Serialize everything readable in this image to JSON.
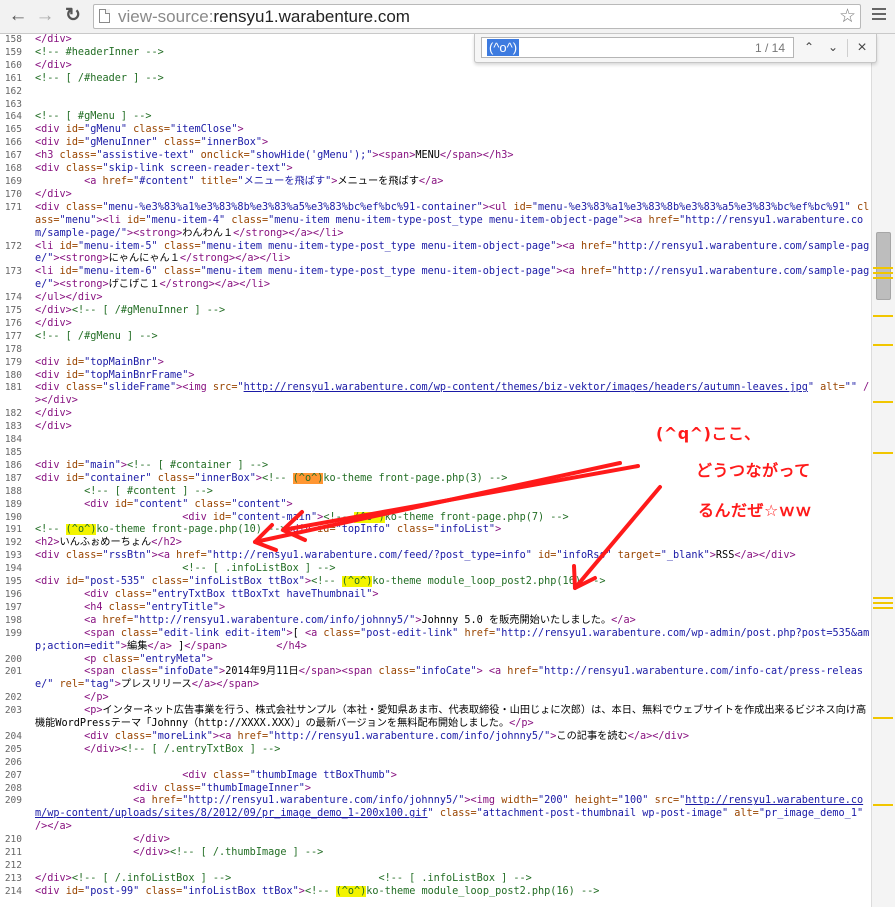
{
  "browser": {
    "url_scheme": "view-source:",
    "url_host": "rensyu1.warabenture.com",
    "back_glyph": "←",
    "forward_glyph": "→",
    "reload_glyph": "↻",
    "star_glyph": "☆"
  },
  "find": {
    "query": "(^o^)",
    "count": "1 / 14",
    "prev_glyph": "⌃",
    "next_glyph": "⌄",
    "close_glyph": "×"
  },
  "annotation": {
    "line1": "(^q^)ここ、",
    "line2": "どうつながって",
    "line3": "るんだぜ☆ｗｗ",
    "color": "#ff1a1a"
  },
  "source_lines": [
    {
      "n": "158",
      "html": "<span class=\"tag\">&lt;/div&gt;</span>"
    },
    {
      "n": "159",
      "html": "<span class=\"cm\">&lt;!-- #headerInner --&gt;</span>"
    },
    {
      "n": "160",
      "html": "<span class=\"tag\">&lt;/div&gt;</span>"
    },
    {
      "n": "161",
      "html": "<span class=\"cm\">&lt;!-- [ /#header ] --&gt;</span>"
    },
    {
      "n": "162",
      "html": ""
    },
    {
      "n": "163",
      "html": ""
    },
    {
      "n": "164",
      "html": "<span class=\"cm\">&lt;!-- [ #gMenu ] --&gt;</span>"
    },
    {
      "n": "165",
      "html": "<span class=\"tag\">&lt;div</span> <span class=\"an\">id=</span><span class=\"av\">\"gMenu\"</span> <span class=\"an\">class=</span><span class=\"av\">\"itemClose\"</span><span class=\"tag\">&gt;</span>"
    },
    {
      "n": "166",
      "html": "<span class=\"tag\">&lt;div</span> <span class=\"an\">id=</span><span class=\"av\">\"gMenuInner\"</span> <span class=\"an\">class=</span><span class=\"av\">\"innerBox\"</span><span class=\"tag\">&gt;</span>"
    },
    {
      "n": "167",
      "html": "<span class=\"tag\">&lt;h3</span> <span class=\"an\">class=</span><span class=\"av\">\"assistive-text\"</span> <span class=\"an\">onclick=</span><span class=\"av\">\"showHide('gMenu');\"</span><span class=\"tag\">&gt;&lt;span&gt;</span>MENU<span class=\"tag\">&lt;/span&gt;&lt;/h3&gt;</span>"
    },
    {
      "n": "168",
      "html": "<span class=\"tag\">&lt;div</span> <span class=\"an\">class=</span><span class=\"av\">\"skip-link screen-reader-text\"</span><span class=\"tag\">&gt;</span>"
    },
    {
      "n": "169",
      "html": "\t<span class=\"tag\">&lt;a</span> <span class=\"an\">href=</span><span class=\"av\">\"#content\"</span> <span class=\"an\">title=</span><span class=\"av\">\"メニューを飛ばす\"</span><span class=\"tag\">&gt;</span>メニューを飛ばす<span class=\"tag\">&lt;/a&gt;</span>"
    },
    {
      "n": "170",
      "html": "<span class=\"tag\">&lt;/div&gt;</span>"
    },
    {
      "n": "171",
      "html": "<span class=\"tag\">&lt;div</span> <span class=\"an\">class=</span><span class=\"av\">\"menu-%e3%83%a1%e3%83%8b%e3%83%a5%e3%83%bc%ef%bc%91-container\"</span><span class=\"tag\">&gt;&lt;ul</span> <span class=\"an\">id=</span><span class=\"av\">\"menu-%e3%83%a1%e3%83%8b%e3%83%a5%e3%83%bc%ef%bc%91\"</span> <span class=\"an\">class=</span><span class=\"av\">\"menu\"</span><span class=\"tag\">&gt;&lt;li</span> <span class=\"an\">id=</span><span class=\"av\">\"menu-item-4\"</span> <span class=\"an\">class=</span><span class=\"av\">\"menu-item menu-item-type-post_type menu-item-object-page\"</span><span class=\"tag\">&gt;&lt;a</span> <span class=\"an\">href=</span><span class=\"av\">\"http://rensyu1.warabenture.com/sample-page/\"</span><span class=\"tag\">&gt;&lt;strong&gt;</span>わんわん１<span class=\"tag\">&lt;/strong&gt;&lt;/a&gt;&lt;/li&gt;</span>"
    },
    {
      "n": "172",
      "html": "<span class=\"tag\">&lt;li</span> <span class=\"an\">id=</span><span class=\"av\">\"menu-item-5\"</span> <span class=\"an\">class=</span><span class=\"av\">\"menu-item menu-item-type-post_type menu-item-object-page\"</span><span class=\"tag\">&gt;&lt;a</span> <span class=\"an\">href=</span><span class=\"av\">\"http://rensyu1.warabenture.com/sample-page/\"</span><span class=\"tag\">&gt;&lt;strong&gt;</span>にゃんにゃん１<span class=\"tag\">&lt;/strong&gt;&lt;/a&gt;&lt;/li&gt;</span>"
    },
    {
      "n": "173",
      "html": "<span class=\"tag\">&lt;li</span> <span class=\"an\">id=</span><span class=\"av\">\"menu-item-6\"</span> <span class=\"an\">class=</span><span class=\"av\">\"menu-item menu-item-type-post_type menu-item-object-page\"</span><span class=\"tag\">&gt;&lt;a</span> <span class=\"an\">href=</span><span class=\"av\">\"http://rensyu1.warabenture.com/sample-page/\"</span><span class=\"tag\">&gt;&lt;strong&gt;</span>げこげこ１<span class=\"tag\">&lt;/strong&gt;&lt;/a&gt;&lt;/li&gt;</span>"
    },
    {
      "n": "174",
      "html": "<span class=\"tag\">&lt;/ul&gt;&lt;/div&gt;</span>"
    },
    {
      "n": "175",
      "html": "<span class=\"tag\">&lt;/div&gt;</span><span class=\"cm\">&lt;!-- [ /#gMenuInner ] --&gt;</span>"
    },
    {
      "n": "176",
      "html": "<span class=\"tag\">&lt;/div&gt;</span>"
    },
    {
      "n": "177",
      "html": "<span class=\"cm\">&lt;!-- [ /#gMenu ] --&gt;</span>"
    },
    {
      "n": "178",
      "html": ""
    },
    {
      "n": "179",
      "html": "<span class=\"tag\">&lt;div</span> <span class=\"an\">id=</span><span class=\"av\">\"topMainBnr\"</span><span class=\"tag\">&gt;</span>"
    },
    {
      "n": "180",
      "html": "<span class=\"tag\">&lt;div</span> <span class=\"an\">id=</span><span class=\"av\">\"topMainBnrFrame\"</span><span class=\"tag\">&gt;</span>"
    },
    {
      "n": "181",
      "html": "<span class=\"tag\">&lt;div</span> <span class=\"an\">class=</span><span class=\"av\">\"slideFrame\"</span><span class=\"tag\">&gt;&lt;img</span> <span class=\"an\">src=</span><span class=\"av\">\"<span class=\"lk\">http://rensyu1.warabenture.com/wp-content/themes/biz-vektor/images/headers/autumn-leaves.jpg</span>\"</span> <span class=\"an\">alt=</span><span class=\"av\">\"\"</span> <span class=\"tag\">/&gt;&lt;/div&gt;</span>"
    },
    {
      "n": "182",
      "html": "<span class=\"tag\">&lt;/div&gt;</span>"
    },
    {
      "n": "183",
      "html": "<span class=\"tag\">&lt;/div&gt;</span>"
    },
    {
      "n": "184",
      "html": ""
    },
    {
      "n": "185",
      "html": ""
    },
    {
      "n": "186",
      "html": "<span class=\"tag\">&lt;div</span> <span class=\"an\">id=</span><span class=\"av\">\"main\"</span><span class=\"tag\">&gt;</span><span class=\"cm\">&lt;!-- [ #container ] --&gt;</span>"
    },
    {
      "n": "187",
      "html": "<span class=\"tag\">&lt;div</span> <span class=\"an\">id=</span><span class=\"av\">\"container\"</span> <span class=\"an\">class=</span><span class=\"av\">\"innerBox\"</span><span class=\"tag\">&gt;</span><span class=\"cm\">&lt;!-- <span class=\"hla\">(^o^)</span>ko-theme front-page.php(3) --&gt;</span>"
    },
    {
      "n": "188",
      "html": "\t<span class=\"cm\">&lt;!-- [ #content ] --&gt;</span>"
    },
    {
      "n": "189",
      "html": "\t<span class=\"tag\">&lt;div</span> <span class=\"an\">id=</span><span class=\"av\">\"content\"</span> <span class=\"an\">class=</span><span class=\"av\">\"content\"</span><span class=\"tag\">&gt;</span>"
    },
    {
      "n": "190",
      "html": "\t\t\t<span class=\"tag\">&lt;div</span> <span class=\"an\">id=</span><span class=\"av\">\"content-main\"</span><span class=\"tag\">&gt;</span><span class=\"cm\">&lt;!-- <span class=\"hl\">(^o^)</span>ko-theme front-page.php(7) --&gt;</span>"
    },
    {
      "n": "191",
      "html": "<span class=\"cm\">&lt;!-- <span class=\"hl\">(^o^)</span>ko-theme front-page.php(10) --&gt;</span><span class=\"tag\">&lt;div</span> <span class=\"an\">id=</span><span class=\"av\">\"topInfo\"</span> <span class=\"an\">class=</span><span class=\"av\">\"infoList\"</span><span class=\"tag\">&gt;</span>"
    },
    {
      "n": "192",
      "html": "<span class=\"tag\">&lt;h2&gt;</span>いんふぉめーちょん<span class=\"tag\">&lt;/h2&gt;</span>"
    },
    {
      "n": "193",
      "html": "<span class=\"tag\">&lt;div</span> <span class=\"an\">class=</span><span class=\"av\">\"rssBtn\"</span><span class=\"tag\">&gt;&lt;a</span> <span class=\"an\">href=</span><span class=\"av\">\"http://rensyu1.warabenture.com/feed/?post_type=info\"</span> <span class=\"an\">id=</span><span class=\"av\">\"infoRss\"</span> <span class=\"an\">target=</span><span class=\"av\">\"_blank\"</span><span class=\"tag\">&gt;</span>RSS<span class=\"tag\">&lt;/a&gt;&lt;/div&gt;</span>"
    },
    {
      "n": "194",
      "html": "\t\t\t<span class=\"cm\">&lt;!-- [ .infoListBox ] --&gt;</span>"
    },
    {
      "n": "195",
      "html": "<span class=\"tag\">&lt;div</span> <span class=\"an\">id=</span><span class=\"av\">\"post-535\"</span> <span class=\"an\">class=</span><span class=\"av\">\"infoListBox ttBox\"</span><span class=\"tag\">&gt;</span><span class=\"cm\">&lt;!-- <span class=\"hl\">(^o^)</span>ko-theme module_loop_post2.php(16) --&gt;</span>"
    },
    {
      "n": "196",
      "html": "\t<span class=\"tag\">&lt;div</span> <span class=\"an\">class=</span><span class=\"av\">\"entryTxtBox ttBoxTxt haveThumbnail\"</span><span class=\"tag\">&gt;</span>"
    },
    {
      "n": "197",
      "html": "\t<span class=\"tag\">&lt;h4</span> <span class=\"an\">class=</span><span class=\"av\">\"entryTitle\"</span><span class=\"tag\">&gt;</span>"
    },
    {
      "n": "198",
      "html": "\t<span class=\"tag\">&lt;a</span> <span class=\"an\">href=</span><span class=\"av\">\"http://rensyu1.warabenture.com/info/johnny5/\"</span><span class=\"tag\">&gt;</span>Johnny 5.0 を販売開始いたしました。<span class=\"tag\">&lt;/a&gt;</span>"
    },
    {
      "n": "199",
      "html": "\t<span class=\"tag\">&lt;span</span> <span class=\"an\">class=</span><span class=\"av\">\"edit-link edit-item\"</span><span class=\"tag\">&gt;</span>[ <span class=\"tag\">&lt;a</span> <span class=\"an\">class=</span><span class=\"av\">\"post-edit-link\"</span> <span class=\"an\">href=</span><span class=\"av\">\"http://rensyu1.warabenture.com/wp-admin/post.php?post=535&amp;amp;action=edit\"</span><span class=\"tag\">&gt;</span>編集<span class=\"tag\">&lt;/a&gt;</span> ]<span class=\"tag\">&lt;/span&gt;</span>\t<span class=\"tag\">&lt;/h4&gt;</span>"
    },
    {
      "n": "200",
      "html": "\t<span class=\"tag\">&lt;p</span> <span class=\"an\">class=</span><span class=\"av\">\"entryMeta\"</span><span class=\"tag\">&gt;</span>"
    },
    {
      "n": "201",
      "html": "\t<span class=\"tag\">&lt;span</span> <span class=\"an\">class=</span><span class=\"av\">\"infoDate\"</span><span class=\"tag\">&gt;</span>2014年9月11日<span class=\"tag\">&lt;/span&gt;&lt;span</span> <span class=\"an\">class=</span><span class=\"av\">\"infoCate\"</span><span class=\"tag\">&gt;</span> <span class=\"tag\">&lt;a</span> <span class=\"an\">href=</span><span class=\"av\">\"http://rensyu1.warabenture.com/info-cat/press-release/\"</span> <span class=\"an\">rel=</span><span class=\"av\">\"tag\"</span><span class=\"tag\">&gt;</span>プレスリリース<span class=\"tag\">&lt;/a&gt;&lt;/span&gt;</span>"
    },
    {
      "n": "202",
      "html": "\t<span class=\"tag\">&lt;/p&gt;</span>"
    },
    {
      "n": "203",
      "html": "\t<span class=\"tag\">&lt;p&gt;</span>インターネット広告事業を行う、株式会社サンプル（本社・愛知県あま市、代表取締役・山田じょに次郎）は、本日、無料でウェブサイトを作成出来るビジネス向け高機能WordPressテーマ「Johnny（http://XXXX.XXX）」の最新バージョンを無料配布開始しました。<span class=\"tag\">&lt;/p&gt;</span>"
    },
    {
      "n": "204",
      "html": "\t<span class=\"tag\">&lt;div</span> <span class=\"an\">class=</span><span class=\"av\">\"moreLink\"</span><span class=\"tag\">&gt;&lt;a</span> <span class=\"an\">href=</span><span class=\"av\">\"http://rensyu1.warabenture.com/info/johnny5/\"</span><span class=\"tag\">&gt;</span>この記事を読む<span class=\"tag\">&lt;/a&gt;&lt;/div&gt;</span>"
    },
    {
      "n": "205",
      "html": "\t<span class=\"tag\">&lt;/div&gt;</span><span class=\"cm\">&lt;!-- [ /.entryTxtBox ] --&gt;</span>"
    },
    {
      "n": "206",
      "html": ""
    },
    {
      "n": "207",
      "html": "\t\t\t<span class=\"tag\">&lt;div</span> <span class=\"an\">class=</span><span class=\"av\">\"thumbImage ttBoxThumb\"</span><span class=\"tag\">&gt;</span>"
    },
    {
      "n": "208",
      "html": "\t\t<span class=\"tag\">&lt;div</span> <span class=\"an\">class=</span><span class=\"av\">\"thumbImageInner\"</span><span class=\"tag\">&gt;</span>"
    },
    {
      "n": "209",
      "html": "\t\t<span class=\"tag\">&lt;a</span> <span class=\"an\">href=</span><span class=\"av\">\"http://rensyu1.warabenture.com/info/johnny5/\"</span><span class=\"tag\">&gt;&lt;img</span> <span class=\"an\">width=</span><span class=\"av\">\"200\"</span> <span class=\"an\">height=</span><span class=\"av\">\"100\"</span> <span class=\"an\">src=</span><span class=\"av\">\"<span class=\"lk\">http://rensyu1.warabenture.com/wp-content/uploads/sites/8/2012/09/pr_image_demo_1-200x100.gif</span>\"</span> <span class=\"an\">class=</span><span class=\"av\">\"attachment-post-thumbnail wp-post-image\"</span> <span class=\"an\">alt=</span><span class=\"av\">\"pr_image_demo_1\"</span> <span class=\"tag\">/&gt;&lt;/a&gt;</span>"
    },
    {
      "n": "210",
      "html": "\t\t<span class=\"tag\">&lt;/div&gt;</span>"
    },
    {
      "n": "211",
      "html": "\t\t<span class=\"tag\">&lt;/div&gt;</span><span class=\"cm\">&lt;!-- [ /.thumbImage ] --&gt;</span>"
    },
    {
      "n": "212",
      "html": ""
    },
    {
      "n": "213",
      "html": "<span class=\"tag\">&lt;/div&gt;</span><span class=\"cm\">&lt;!-- [ /.infoListBox ] --&gt;</span>\t\t\t<span class=\"cm\">&lt;!-- [ .infoListBox ] --&gt;</span>"
    },
    {
      "n": "214",
      "html": "<span class=\"tag\">&lt;div</span> <span class=\"an\">id=</span><span class=\"av\">\"post-99\"</span> <span class=\"an\">class=</span><span class=\"av\">\"infoListBox ttBox\"</span><span class=\"tag\">&gt;</span><span class=\"cm\">&lt;!-- <span class=\"hl\">(^o^)</span>ko-theme module_loop_post2.php(16) --&gt;</span>"
    }
  ]
}
